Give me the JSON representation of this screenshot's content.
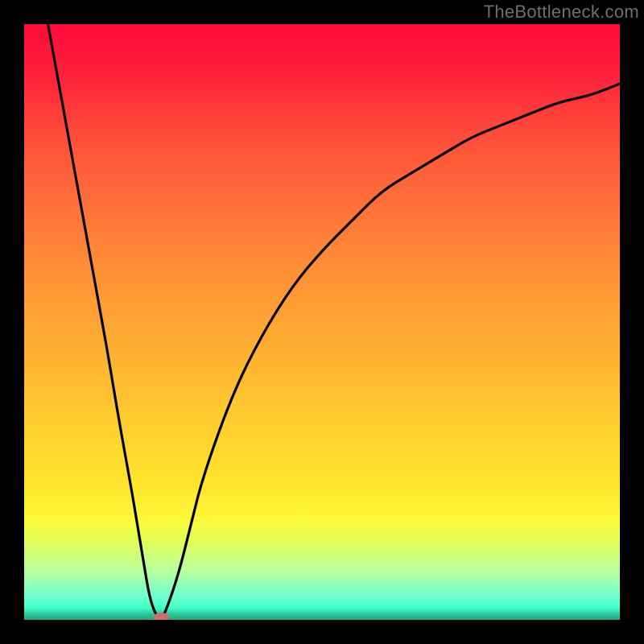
{
  "watermark": "TheBottleneck.com",
  "chart_data": {
    "type": "line",
    "title": "",
    "xlabel": "",
    "ylabel": "",
    "xlim": [
      0,
      100
    ],
    "ylim": [
      0,
      100
    ],
    "grid": false,
    "legend": false,
    "background_gradient": {
      "top": "#ff0b3a",
      "middle": "#ffd52e",
      "bottom": "#2aa46e"
    },
    "series": [
      {
        "name": "bottleneck-curve",
        "color": "#000000",
        "x": [
          4,
          6,
          8,
          10,
          12,
          14,
          16,
          18,
          19,
          20,
          21,
          22,
          23,
          24,
          26,
          28,
          30,
          35,
          40,
          45,
          50,
          55,
          60,
          65,
          70,
          75,
          80,
          85,
          90,
          95,
          100
        ],
        "y": [
          100,
          89,
          78,
          67,
          56,
          45,
          33,
          22,
          16,
          10,
          4,
          1,
          0,
          2,
          8,
          16,
          24,
          38,
          48,
          56,
          62,
          67,
          72,
          75,
          78,
          81,
          83,
          85,
          87,
          88,
          90
        ]
      }
    ],
    "marker": {
      "x": 23,
      "y": 0,
      "color": "#c96f6f",
      "shape": "ellipse"
    }
  }
}
